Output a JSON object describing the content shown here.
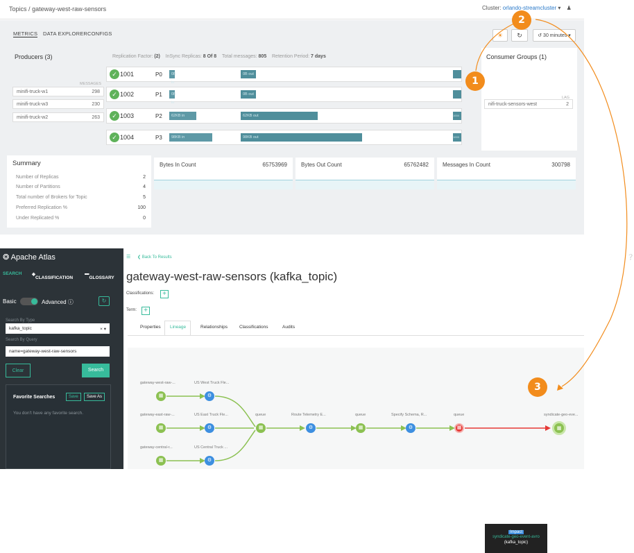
{
  "breadcrumb": {
    "root": "Topics",
    "sep": "/",
    "topic": "gateway-west-raw-sensors"
  },
  "cluster": {
    "label": "Cluster:",
    "value": "orlando-streamcluster",
    "caret": "▾",
    "user_icon": "user-icon"
  },
  "tabs": [
    {
      "label": "METRICS"
    },
    {
      "label": "DATA EXPLORER"
    },
    {
      "label": "CONFIGS"
    }
  ],
  "time_range": "30 minutes",
  "producers": {
    "title": "Producers (3)",
    "col": "MESSAGES",
    "rows": [
      {
        "name": "minifi-truck-w1",
        "count": "298"
      },
      {
        "name": "minifi-truck-w3",
        "count": "230"
      },
      {
        "name": "minifi-truck-w2",
        "count": "263"
      }
    ]
  },
  "replication": {
    "factor_label": "Replication Factor:",
    "factor_value": "(2)",
    "insync_label": "InSync Replicas:",
    "insync_value": "8 Of 8",
    "total_label": "Total messages:",
    "total_value": "805",
    "retention_label": "Retention Period:",
    "retention_value": "7 days"
  },
  "brokers": [
    {
      "id": "1001",
      "partition": "P0",
      "in": "0B in",
      "out": "0B out",
      "end": "",
      "in_frac": 0.06,
      "out_frac": 0.07
    },
    {
      "id": "1002",
      "partition": "P1",
      "in": "0B in",
      "out": "0B out",
      "end": "",
      "in_frac": 0.06,
      "out_frac": 0.07
    },
    {
      "id": "1003",
      "partition": "P2",
      "in": "62KB in",
      "out": "62KB out",
      "end": "1004",
      "in_frac": 0.28,
      "out_frac": 0.35
    },
    {
      "id": "1004",
      "partition": "P3",
      "in": "98KB in",
      "out": "98KB out",
      "end": "1003",
      "in_frac": 0.44,
      "out_frac": 0.55
    }
  ],
  "consumers": {
    "title": "Consumer Groups (1)",
    "col": "LAG",
    "rows": [
      {
        "name": "nifi-truck-sensors-west",
        "lag": "2"
      }
    ]
  },
  "summary": {
    "title": "Summary",
    "rows": [
      {
        "label": "Number of Replicas",
        "value": "2"
      },
      {
        "label": "Number of Partitions",
        "value": "4"
      },
      {
        "label": "Total number of Brokers for Topic",
        "value": "5"
      },
      {
        "label": "Preferred Replication %",
        "value": "100"
      },
      {
        "label": "Under Replicated %",
        "value": "0"
      }
    ]
  },
  "metrics": [
    {
      "label": "Bytes In Count",
      "value": "65753969"
    },
    {
      "label": "Bytes Out Count",
      "value": "65762482"
    },
    {
      "label": "Messages In Count",
      "value": "300798"
    }
  ],
  "atlas": {
    "app_title": "Apache Atlas",
    "side_tabs": [
      "SEARCH",
      "CLASSIFICATION",
      "GLOSSARY"
    ],
    "basic": "Basic",
    "advanced": "Advanced",
    "search_by_type_label": "Search By Type",
    "search_by_type_value": "kafka_topic",
    "search_by_query_label": "Search By Query",
    "search_by_query_value": "name=gateway-west-raw-sensors",
    "clear": "Clear",
    "search": "Search",
    "fav_title": "Favorite Searches",
    "fav_save": "Save",
    "fav_save_as": "Save As",
    "fav_empty": "You don't have any favorite search.",
    "back": "Back To Results",
    "entity_title": "gateway-west-raw-sensors (kafka_topic)",
    "classifications_label": "Classifications:",
    "term_label": "Term:",
    "entity_tabs": [
      "Properties",
      "Lineage",
      "Relationships",
      "Classifications",
      "Audits"
    ],
    "nodes": [
      {
        "label": "gateway-west-raw-..."
      },
      {
        "label": "US West Truck Fle..."
      },
      {
        "label": "gateway-east-raw-..."
      },
      {
        "label": "US East Truck Fle..."
      },
      {
        "label": "queue"
      },
      {
        "label": "Route Telemetry E..."
      },
      {
        "label": "queue"
      },
      {
        "label": "Specify Schema, R..."
      },
      {
        "label": "queue"
      },
      {
        "label": "syndicate-geo-eve..."
      },
      {
        "label": "gateway-central-r..."
      },
      {
        "label": "US Central Truck ..."
      }
    ],
    "tooltip": {
      "header": "Impact",
      "name": "syndicate-geo-event-avro",
      "type": "(kafka_topic)"
    }
  },
  "callouts": [
    "1",
    "2",
    "3"
  ],
  "colors": {
    "accent": "#f28c1c",
    "bar": "#4f8e9b",
    "green": "#5fb25a",
    "atlas_green": "#37bb9b",
    "atlas_blue": "#3d8fe0"
  }
}
